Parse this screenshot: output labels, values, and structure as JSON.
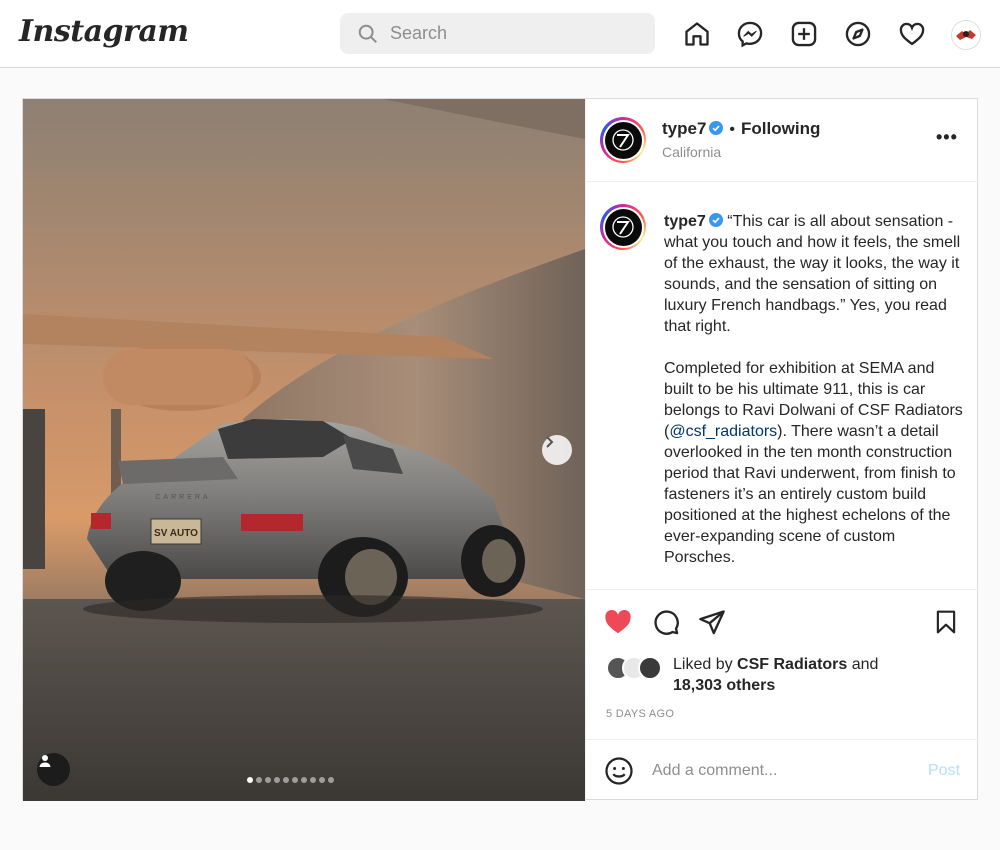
{
  "header": {
    "logo": "Instagram",
    "search_placeholder": "Search",
    "nav_icons": [
      "home-icon",
      "messenger-icon",
      "new-post-icon",
      "explore-icon",
      "activity-heart-icon",
      "profile-avatar"
    ]
  },
  "post": {
    "username": "type7",
    "follow_status": "Following",
    "location": "California",
    "more_label": "•••",
    "caption_p1": "“This car is all about sensation - what you touch and how it feels, the smell of the exhaust, the way it looks, the way it sounds, and the sensation of sitting on luxury French handbags.” Yes, you read that right.",
    "caption_p2_before": "Completed for exhibition at SEMA and built to be his ultimate 911, this is car belongs to Ravi Dolwani of CSF Radiators (",
    "caption_mention": "@csf_radiators",
    "caption_p2_after": "). There wasn’t a detail overlooked in the ten month construction period that Ravi underwent, from finish to fasteners it’s an entirely custom build positioned at the highest echelons of the ever-expanding scene of custom Porsches.",
    "liked_by_prefix": "Liked by",
    "liked_by_user": "CSF Radiators",
    "liked_by_and": "and",
    "likes_others": "18,303 others",
    "time_ago": "5 DAYS AGO",
    "comment_placeholder": "Add a comment...",
    "post_button": "Post",
    "carousel": {
      "total_slides": 10,
      "active_index": 0
    },
    "photo_plate_text": "SV AUTO",
    "photo_badge_text": "CARRERA"
  },
  "colors": {
    "like_red": "#ed4956",
    "link_blue": "#00376b",
    "post_button_blue": "#b2dffc",
    "verified_blue": "#3897f0"
  }
}
